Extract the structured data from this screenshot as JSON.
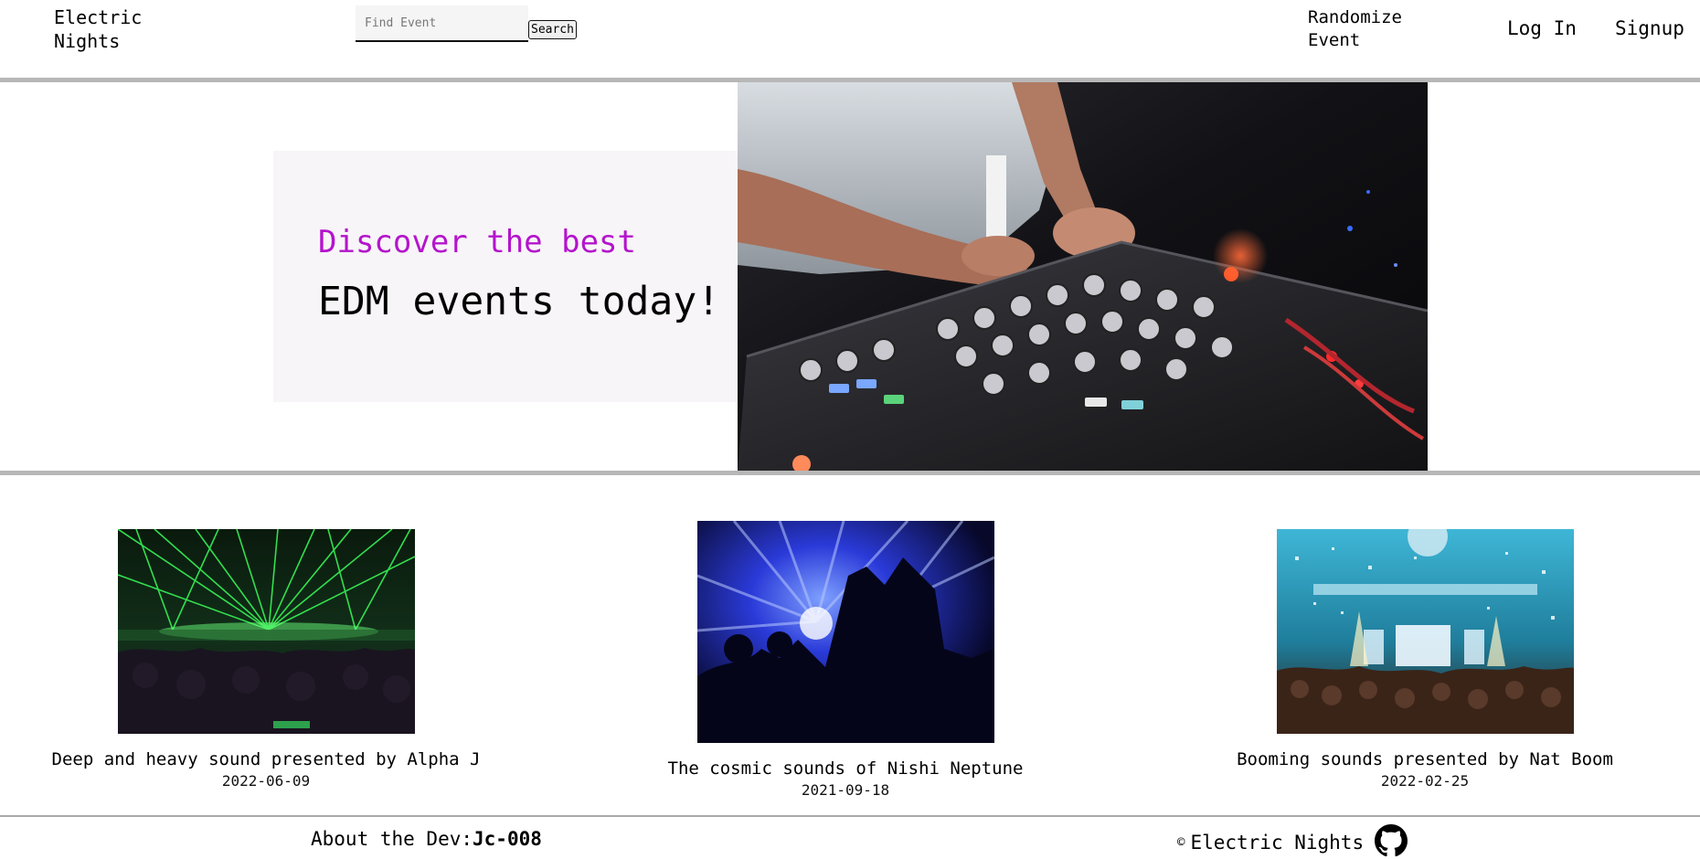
{
  "header": {
    "brand": "Electric\nNights",
    "search": {
      "placeholder": "Find Event",
      "value": "",
      "button_label": "Search"
    },
    "nav": {
      "randomize": "Randomize\nEvent",
      "login": "Log In",
      "signup": "Signup"
    }
  },
  "hero": {
    "kicker": "Discover the best",
    "title": "EDM events today!",
    "image_icon": "dj-mixer-photo"
  },
  "events": [
    {
      "title": "Deep and heavy sound presented by Alpha J",
      "date": "2022-06-09",
      "image_icon": "green-laser-concert-photo"
    },
    {
      "title": "The cosmic sounds of Nishi Neptune",
      "date": "2021-09-18",
      "image_icon": "blue-light-crowd-photo"
    },
    {
      "title": "Booming sounds presented by Nat Boom",
      "date": "2022-02-25",
      "image_icon": "confetti-club-photo"
    }
  ],
  "footer": {
    "about_label": "About the Dev:",
    "dev_handle": "Jc-008",
    "copyright_symbol": "©",
    "copyright_text": "Electric Nights",
    "icon": "github-icon"
  },
  "colors": {
    "accent": "#b414cc",
    "divider": "#b7b7b7",
    "hero_panel": "#f7f5f7"
  }
}
